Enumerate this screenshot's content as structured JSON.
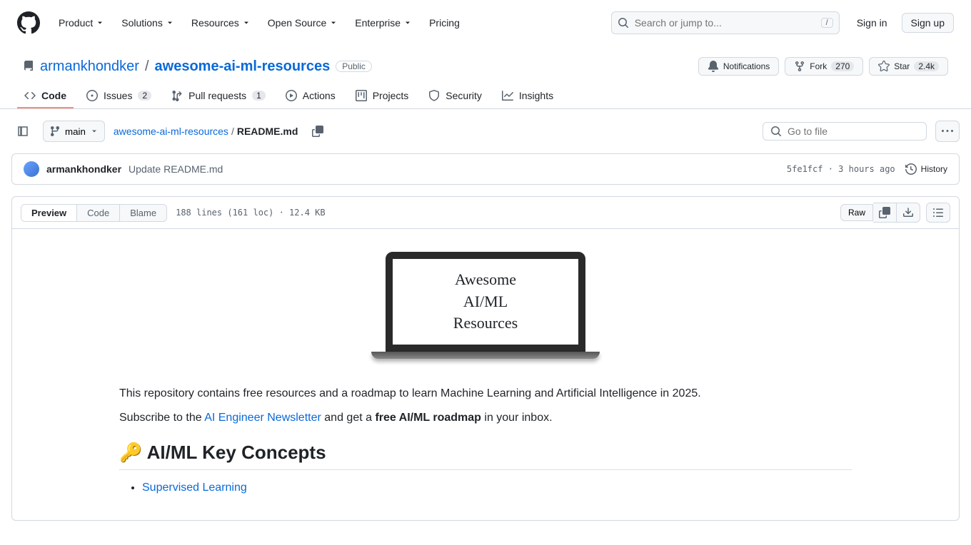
{
  "header": {
    "nav": [
      "Product",
      "Solutions",
      "Resources",
      "Open Source",
      "Enterprise",
      "Pricing"
    ],
    "search_placeholder": "Search or jump to...",
    "search_kbd": "/",
    "sign_in": "Sign in",
    "sign_up": "Sign up"
  },
  "repo": {
    "icon": "repo",
    "owner": "armankhondker",
    "name": "awesome-ai-ml-resources",
    "visibility": "Public",
    "actions": {
      "notifications": "Notifications",
      "fork": "Fork",
      "fork_count": "270",
      "star": "Star",
      "star_count": "2.4k"
    }
  },
  "reponav": [
    {
      "label": "Code",
      "selected": true
    },
    {
      "label": "Issues",
      "count": "2"
    },
    {
      "label": "Pull requests",
      "count": "1"
    },
    {
      "label": "Actions"
    },
    {
      "label": "Projects"
    },
    {
      "label": "Security"
    },
    {
      "label": "Insights"
    }
  ],
  "file": {
    "branch": "main",
    "breadcrumb_root": "awesome-ai-ml-resources",
    "breadcrumb_file": "README.md",
    "goto_placeholder": "Go to file"
  },
  "commit": {
    "author": "armankhondker",
    "message": "Update README.md",
    "sha": "5fe1fcf",
    "sep": "·",
    "time": "3 hours ago",
    "history": "History"
  },
  "toolbar": {
    "tabs": [
      "Preview",
      "Code",
      "Blame"
    ],
    "active_tab": 0,
    "stats": "188 lines (161 loc) · 12.4 KB",
    "raw": "Raw"
  },
  "readme": {
    "hero_lines": [
      "Awesome",
      "AI/ML",
      "Resources"
    ],
    "intro": "This repository contains free resources and a roadmap to learn Machine Learning and Artificial Intelligence in 2025.",
    "subscribe_prefix": "Subscribe to the ",
    "subscribe_link": "AI Engineer Newsletter",
    "subscribe_mid": " and get a ",
    "subscribe_bold": "free AI/ML roadmap",
    "subscribe_suffix": " in your inbox.",
    "h2": "🔑 AI/ML Key Concepts",
    "list": [
      "Supervised Learning"
    ]
  }
}
